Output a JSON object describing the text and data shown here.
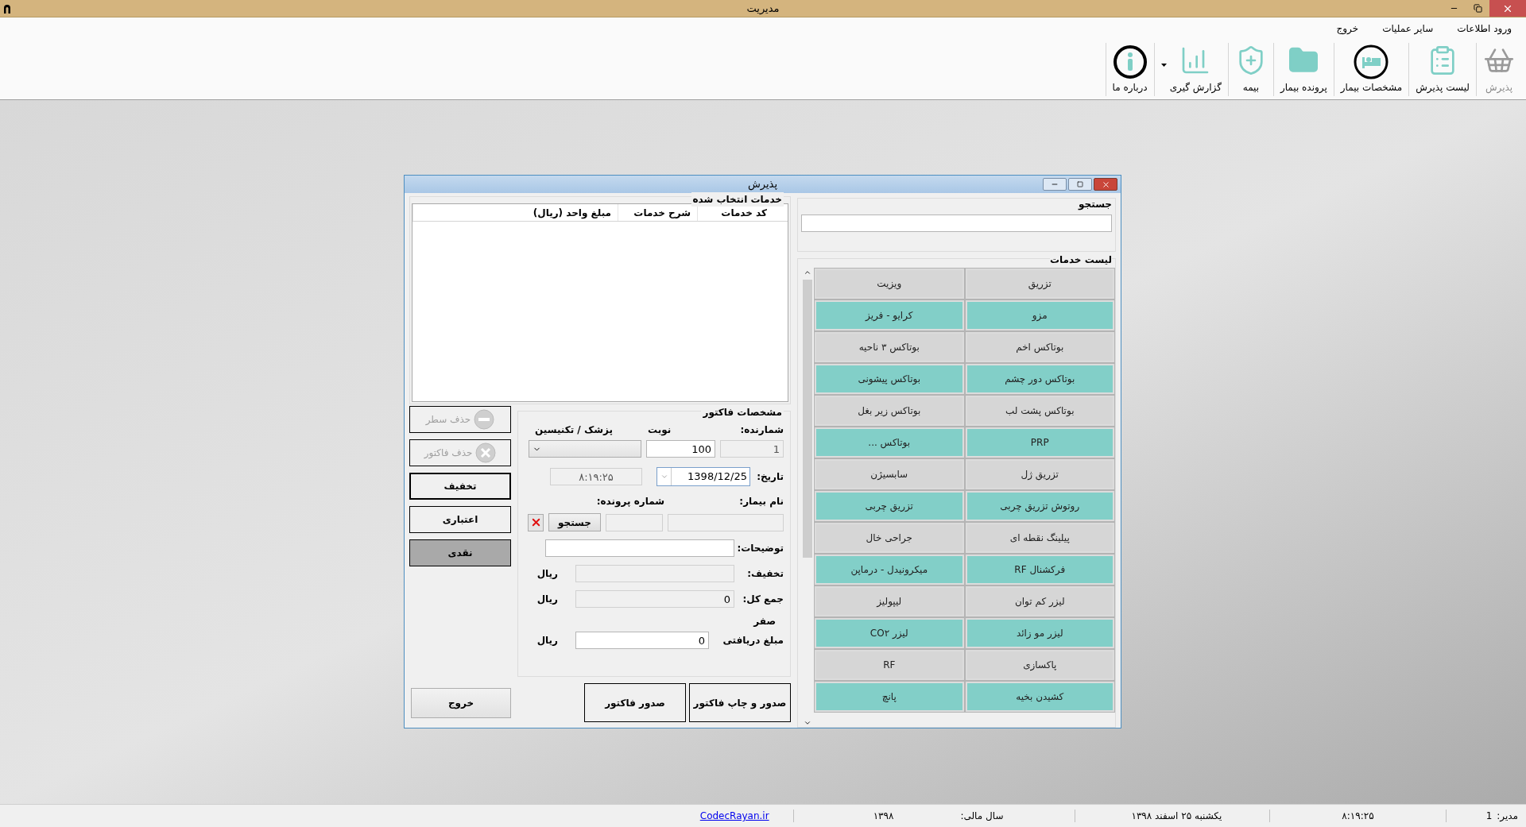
{
  "window": {
    "title": "مدیریت"
  },
  "menu": [
    "ورود اطلاعات",
    "سایر عملیات",
    "خروج"
  ],
  "toolbar": [
    {
      "label": "پذیرش",
      "kind": "basket",
      "disabled": true,
      "dropdown": false
    },
    {
      "label": "لیست پذیرش",
      "kind": "clipboard",
      "disabled": false,
      "dropdown": false
    },
    {
      "label": "مشخصات بیمار",
      "kind": "bed",
      "disabled": false,
      "dropdown": false
    },
    {
      "label": "پرونده بیمار",
      "kind": "folder",
      "disabled": false,
      "dropdown": false
    },
    {
      "label": "بیمه",
      "kind": "insurance",
      "disabled": false,
      "dropdown": false
    },
    {
      "label": "گزارش گیری",
      "kind": "report",
      "disabled": false,
      "dropdown": true
    },
    {
      "label": "درباره ما",
      "kind": "info",
      "disabled": false,
      "dropdown": false
    }
  ],
  "dialog": {
    "title": "پذیرش",
    "search": {
      "label": "جستجو"
    },
    "services": {
      "label": "لیست خدمات",
      "items": [
        {
          "label": "تزریق",
          "color": "#d6d6d6"
        },
        {
          "label": "ویزیت",
          "color": "#d6d6d6"
        },
        {
          "label": "مزو",
          "color": "#82cfc8"
        },
        {
          "label": "کرایو - فریز",
          "color": "#82cfc8"
        },
        {
          "label": "بوتاکس اخم",
          "color": "#d6d6d6"
        },
        {
          "label": "بوتاکس ۳ ناحیه",
          "color": "#d6d6d6"
        },
        {
          "label": "بوتاکس دور چشم",
          "color": "#82cfc8"
        },
        {
          "label": "بوتاکس پیشونی",
          "color": "#82cfc8"
        },
        {
          "label": "بوتاکس پشت لب",
          "color": "#d6d6d6"
        },
        {
          "label": "بوتاکس زیر بغل",
          "color": "#d6d6d6"
        },
        {
          "label": "PRP",
          "color": "#82cfc8"
        },
        {
          "label": "بوتاکس ...",
          "color": "#82cfc8"
        },
        {
          "label": "تزریق ژل",
          "color": "#d6d6d6"
        },
        {
          "label": "سابسیژن",
          "color": "#d6d6d6"
        },
        {
          "label": "روتوش تزریق چربی",
          "color": "#82cfc8"
        },
        {
          "label": "تزریق چربی",
          "color": "#82cfc8"
        },
        {
          "label": "پیلینگ نقطه ای",
          "color": "#d6d6d6"
        },
        {
          "label": "جراحی خال",
          "color": "#d6d6d6"
        },
        {
          "label": "فرکشنال RF",
          "color": "#82cfc8"
        },
        {
          "label": "میکرونیدل - درماپن",
          "color": "#82cfc8"
        },
        {
          "label": "لیزر کم توان",
          "color": "#d6d6d6"
        },
        {
          "label": "لیپولیز",
          "color": "#d6d6d6"
        },
        {
          "label": "لیزر مو زائد",
          "color": "#82cfc8"
        },
        {
          "label": "لیزر CO۲",
          "color": "#82cfc8"
        },
        {
          "label": "پاکسازی",
          "color": "#d6d6d6"
        },
        {
          "label": "RF",
          "color": "#d6d6d6"
        },
        {
          "label": "کشیدن بخیه",
          "color": "#82cfc8"
        },
        {
          "label": "پانچ",
          "color": "#82cfc8"
        }
      ]
    },
    "selected_services": {
      "label": "خدمات انتخاب شده",
      "columns": [
        "کد خدمات",
        "شرح خدمات",
        "مبلغ واحد (ریال)"
      ]
    },
    "side_buttons": [
      {
        "label": "حذف سطر",
        "kind": "remove",
        "disabled": true,
        "selected": false
      },
      {
        "label": "حذف فاکتور",
        "kind": "delete",
        "disabled": true,
        "selected": false
      },
      {
        "label": "تخفیف",
        "kind": "plain",
        "disabled": false,
        "selected": false
      },
      {
        "label": "اعتباری",
        "kind": "plain",
        "disabled": false,
        "selected": false
      },
      {
        "label": "نقدی",
        "kind": "plain",
        "disabled": false,
        "selected": true
      }
    ],
    "invoice": {
      "label": "مشخصات فاکتور",
      "counter": {
        "label": "شمارنده:",
        "value": "1"
      },
      "turn": {
        "label": "نوبت",
        "value": "100"
      },
      "doctor": {
        "label": "پزشک / تکنیسین"
      },
      "date": {
        "label": "تاریخ:",
        "value": "1398/12/25"
      },
      "time": {
        "value": "۸:۱۹:۲۵"
      },
      "patient_name": {
        "label": "نام بیمار:"
      },
      "file_number": {
        "label": "شماره پرونده:"
      },
      "search_button": "جستجو",
      "notes": {
        "label": "توضیحات:"
      },
      "discount": {
        "label": "تخفیف:",
        "unit": "ریال"
      },
      "total": {
        "label": "جمع کل:",
        "value": "0",
        "unit": "ریال"
      },
      "total_words": "صفر",
      "received": {
        "label": "مبلغ دریافتی",
        "value": "0",
        "unit": "ریال"
      }
    },
    "bottom_buttons": [
      "صدور و چاپ فاکتور",
      "صدور فاکتور"
    ],
    "exit_button": "خروج"
  },
  "status_bar": {
    "user_label": "مدیر:",
    "user": "1",
    "time": "۸:۱۹:۲۵",
    "date": "یکشنبه ۲۵ اسفند ۱۳۹۸",
    "fiscal_label": "سال مالی:",
    "fiscal_year": "۱۳۹۸",
    "link": "CodecRayan.ir"
  }
}
